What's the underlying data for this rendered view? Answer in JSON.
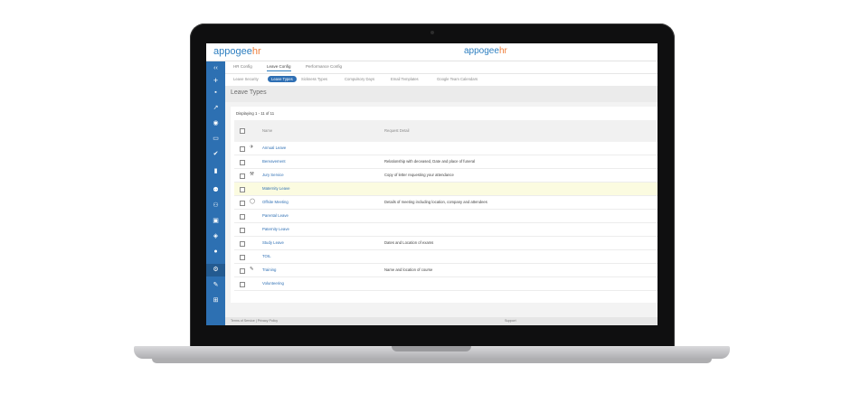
{
  "app": {
    "logo_part1": "appogee",
    "logo_part2": "hr"
  },
  "sidebar": {
    "items": [
      {
        "icon": "collapse-icon",
        "glyph": "‹‹"
      },
      {
        "icon": "plus-icon",
        "glyph": "+"
      },
      {
        "icon": "briefcase-icon",
        "glyph": "▪"
      },
      {
        "icon": "trend-icon",
        "glyph": "↗"
      },
      {
        "icon": "location-icon",
        "glyph": "◉"
      },
      {
        "icon": "devices-icon",
        "glyph": "▭"
      },
      {
        "icon": "check-circle-icon",
        "glyph": "✔"
      },
      {
        "icon": "bar-chart-icon",
        "glyph": "▮"
      },
      {
        "icon": "people-icon",
        "glyph": "⚉"
      },
      {
        "icon": "add-person-icon",
        "glyph": "⚇"
      },
      {
        "icon": "badge-icon",
        "glyph": "▣"
      },
      {
        "icon": "shield-icon",
        "glyph": "◈"
      },
      {
        "icon": "account-icon",
        "glyph": "●"
      },
      {
        "icon": "gear-icon",
        "glyph": "⚙"
      },
      {
        "icon": "wrench-icon",
        "glyph": "✎"
      },
      {
        "icon": "cart-icon",
        "glyph": "⊞"
      }
    ]
  },
  "tabs_main": [
    "HR Config",
    "Leave Config",
    "Performance Config"
  ],
  "tabs_sub": [
    "Leave Security",
    "Leave Types",
    "Sickness Types",
    "Compulsory Days",
    "Email Templates",
    "Google Team Calendars"
  ],
  "page": {
    "title": "Leave Types",
    "count": "Displaying 1 - 11 of 11"
  },
  "table": {
    "headers": [
      "Name",
      "Request Detail"
    ],
    "rows": [
      {
        "name": "Annual Leave",
        "detail": "",
        "icon": "airplane-icon",
        "glyph": "✈"
      },
      {
        "name": "Bereavement",
        "detail": "Relationship with deceased, Date and place of funeral",
        "icon": "",
        "glyph": ""
      },
      {
        "name": "Jury Service",
        "detail": "Copy of letter requesting your attendance",
        "icon": "gavel-icon",
        "glyph": "⚒"
      },
      {
        "name": "Maternity Leave",
        "detail": "",
        "icon": "",
        "glyph": ""
      },
      {
        "name": "Offsite Meeting",
        "detail": "Details of meeting including location, company and attendees",
        "icon": "speech-bubble-icon",
        "glyph": "◯"
      },
      {
        "name": "Parental Leave",
        "detail": "",
        "icon": "",
        "glyph": ""
      },
      {
        "name": "Paternity Leave",
        "detail": "",
        "icon": "",
        "glyph": ""
      },
      {
        "name": "Study Leave",
        "detail": "Dates and Location of exams",
        "icon": "",
        "glyph": ""
      },
      {
        "name": "TOIL",
        "detail": "",
        "icon": "",
        "glyph": ""
      },
      {
        "name": "Training",
        "detail": "Name and location of course",
        "icon": "pencil-icon",
        "glyph": "✎"
      },
      {
        "name": "Volunteering",
        "detail": "",
        "icon": "",
        "glyph": ""
      }
    ]
  },
  "footer": {
    "left": "Terms of Service | Privacy Policy",
    "right": "Support"
  }
}
